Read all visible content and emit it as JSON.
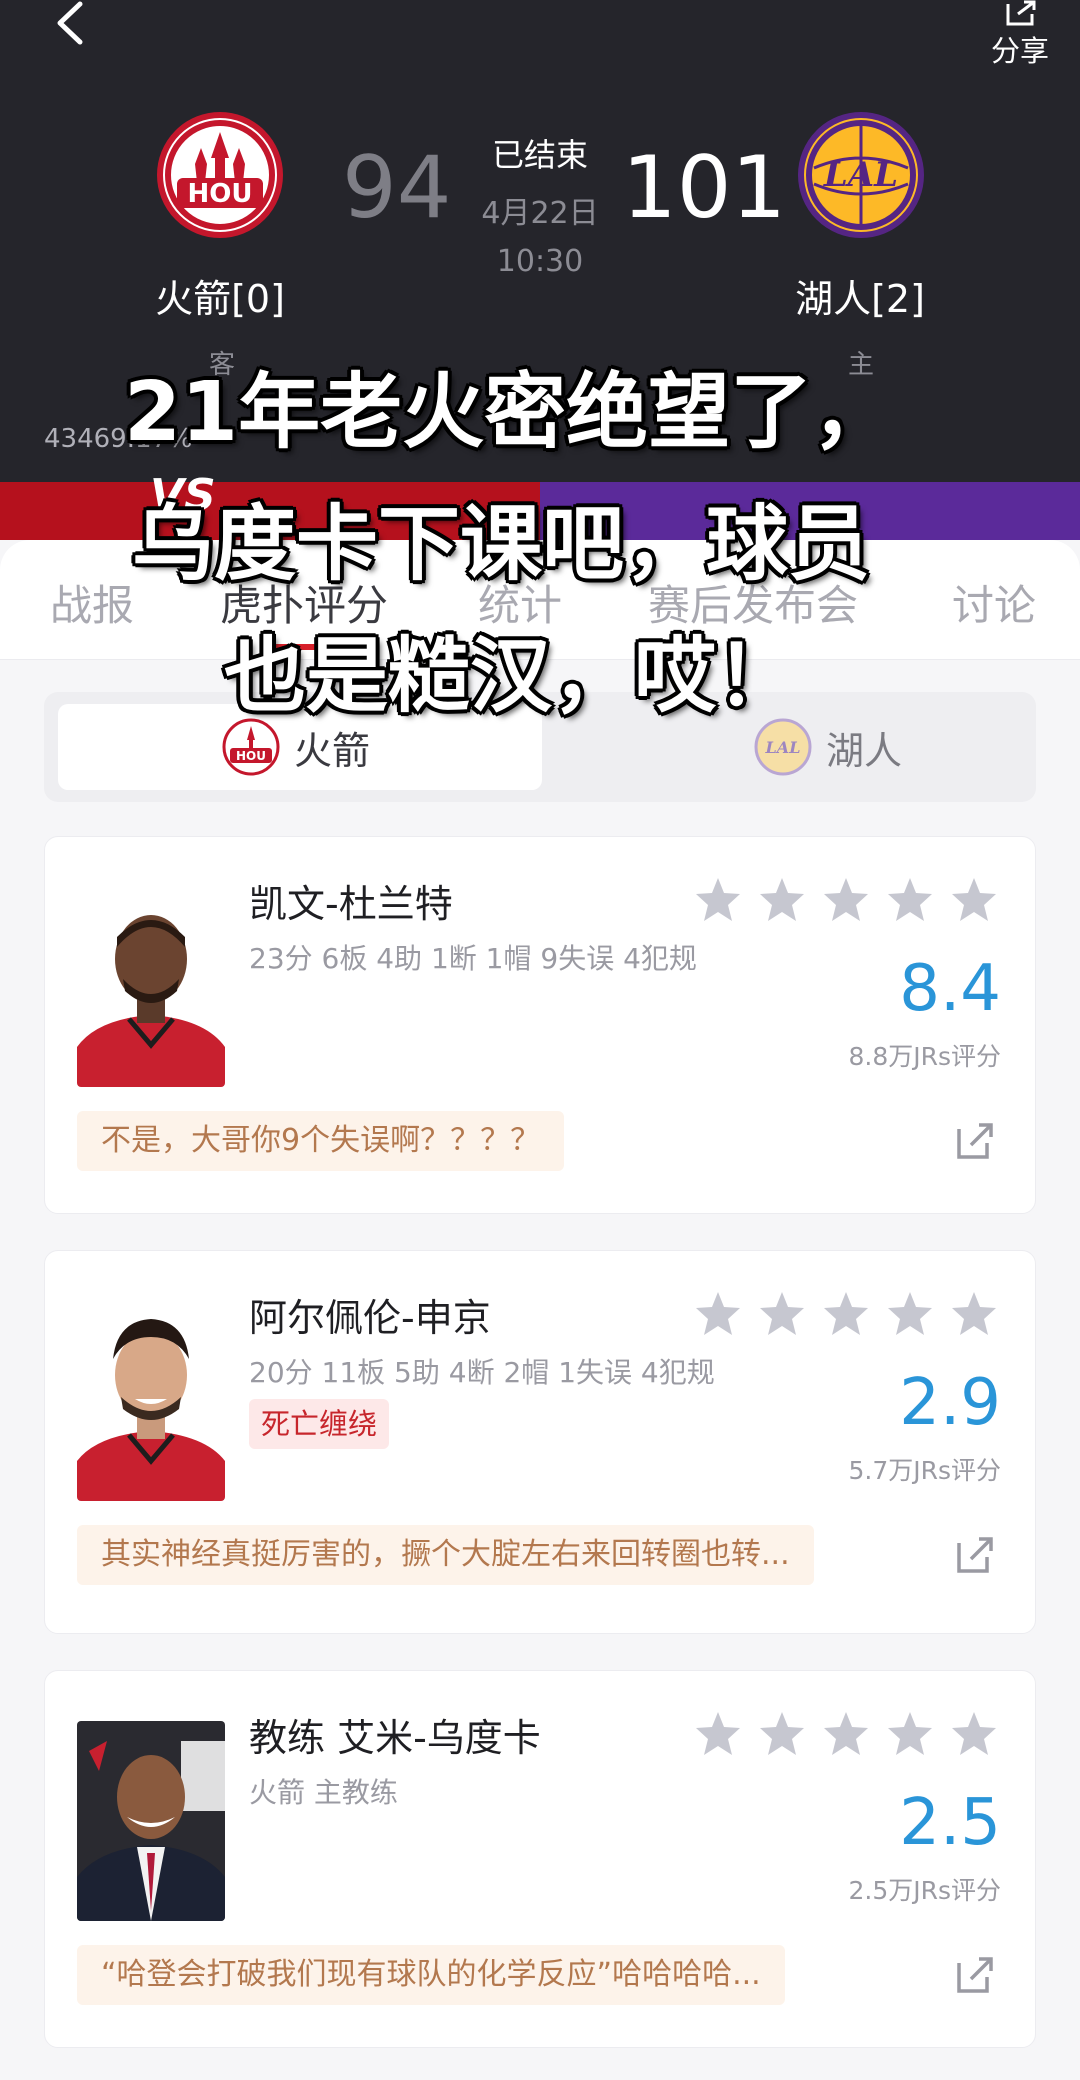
{
  "header": {
    "back_icon": "chevron-left-icon",
    "share_icon": "share-icon",
    "share_label": "分享",
    "game_status": "已结束",
    "game_date": "4月22日",
    "game_time": "10:30",
    "away": {
      "name": "火箭[0]",
      "score": "94",
      "side": "客",
      "logo_text": "HOU",
      "color": "#c4172c"
    },
    "home": {
      "name": "湖人[2]",
      "score": "101",
      "side": "主",
      "logo_text": "LAL",
      "color": "#552583"
    },
    "hits_text": "43469.17%",
    "vs_text": "VS"
  },
  "tabs": [
    {
      "label": "战报"
    },
    {
      "label": "虎扑评分",
      "active": true
    },
    {
      "label": "统计"
    },
    {
      "label": "赛后发布会"
    },
    {
      "label": "讨论"
    }
  ],
  "team_switch": {
    "options": [
      {
        "label": "火箭",
        "logo_text": "HOU",
        "active": true
      },
      {
        "label": "湖人",
        "logo_text": "LAL",
        "active": false
      }
    ]
  },
  "players": [
    {
      "name": "凯文-杜兰特",
      "stats": "23分 6板 4助 1断 1帽 9失误 4犯规",
      "nickname": "",
      "stars": 5,
      "rating": "8.4",
      "rating_count": "8.8万JRs评分",
      "comment": "不是，大哥你9个失误啊？？？？"
    },
    {
      "name": "阿尔佩伦-申京",
      "stats": "20分 11板 5助 4断 2帽 1失误 4犯规",
      "nickname": "死亡缠绕",
      "stars": 5,
      "rating": "2.9",
      "rating_count": "5.7万JRs评分",
      "comment": "其实神经真挺厉害的，撅个大腚左右来回转圈也转..."
    },
    {
      "name": "教练 艾米-乌度卡",
      "stats": "火箭 主教练",
      "nickname": "",
      "stars": 5,
      "rating": "2.5",
      "rating_count": "2.5万JRs评分",
      "comment": "“哈登会打破我们现有球队的化学反应”哈哈哈哈..."
    }
  ],
  "overlay_caption": {
    "line1": "21年老火密绝望了，",
    "line2": "乌度卡下课吧，球员",
    "line3": "也是糙汉，哎！"
  },
  "colors": {
    "header_bg": "#25252b",
    "rating_blue": "#2a95d8",
    "active_underline": "#d7202a",
    "comment_text": "#b3784e",
    "star_gray": "#c6c7d0"
  }
}
